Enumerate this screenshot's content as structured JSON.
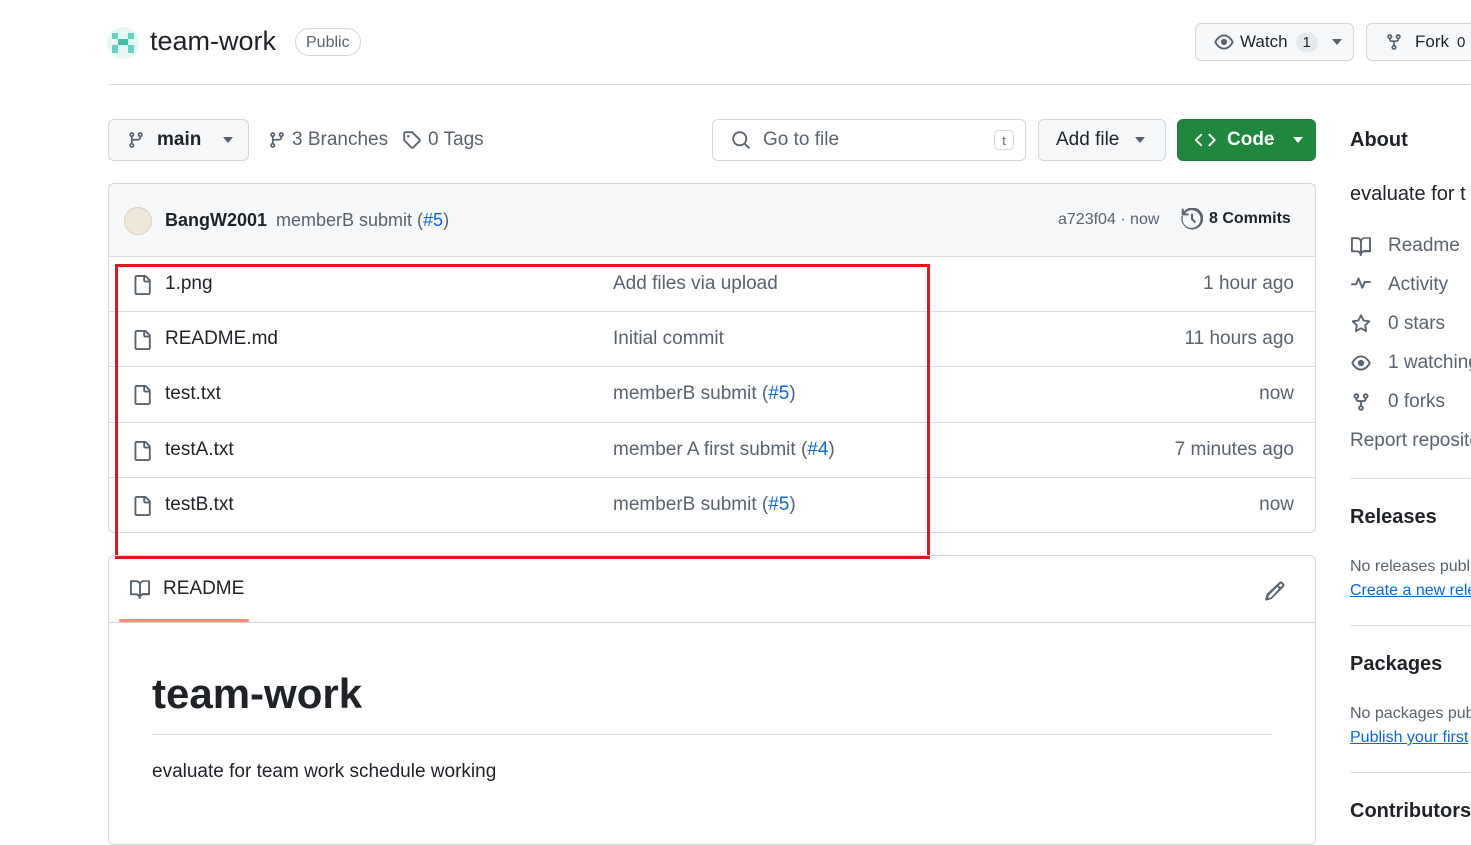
{
  "repo": {
    "name": "team-work",
    "visibility": "Public",
    "watch_label": "Watch",
    "watch_count": "1",
    "fork_label": "Fork",
    "fork_count": "0"
  },
  "toolbar": {
    "branch": "main",
    "branches": "3 Branches",
    "tags": "0 Tags",
    "search_placeholder": "Go to file",
    "search_shortcut": "t",
    "add_file": "Add file",
    "code": "Code"
  },
  "commit": {
    "author": "BangW2001",
    "message": "memberB submit (",
    "pr": "#5",
    "pr_close": ")",
    "hash": "a723f04 · now",
    "commits": "8 Commits"
  },
  "files": [
    {
      "name": "1.png",
      "msg": "Add files via upload",
      "pr": "",
      "time": "1 hour ago"
    },
    {
      "name": "README.md",
      "msg": "Initial commit",
      "pr": "",
      "time": "11 hours ago"
    },
    {
      "name": "test.txt",
      "msg": "memberB submit (",
      "pr": "#5",
      "time": "now"
    },
    {
      "name": "testA.txt",
      "msg": "member A first submit (",
      "pr": "#4",
      "time": "7 minutes ago"
    },
    {
      "name": "testB.txt",
      "msg": "memberB submit (",
      "pr": "#5",
      "time": "now"
    }
  ],
  "readme": {
    "tab": "README",
    "title": "team-work",
    "body": "evaluate for team work schedule working"
  },
  "sidebar": {
    "about": "About",
    "description": "evaluate for t",
    "readme": "Readme",
    "activity": "Activity",
    "stars": "0 stars",
    "watching": "1 watching",
    "forks": "0 forks",
    "report": "Report reposito",
    "releases": "Releases",
    "no_releases": "No releases publi",
    "create_release": "Create a new rele",
    "packages": "Packages",
    "no_packages": "No packages pub",
    "publish_package": "Publish your first",
    "contributors": "Contributors"
  },
  "colors": {
    "accent": "#0969da",
    "code_button": "#1f883d",
    "highlight_box": "#e5141e",
    "readme_tab_underline": "#fd8c73"
  }
}
